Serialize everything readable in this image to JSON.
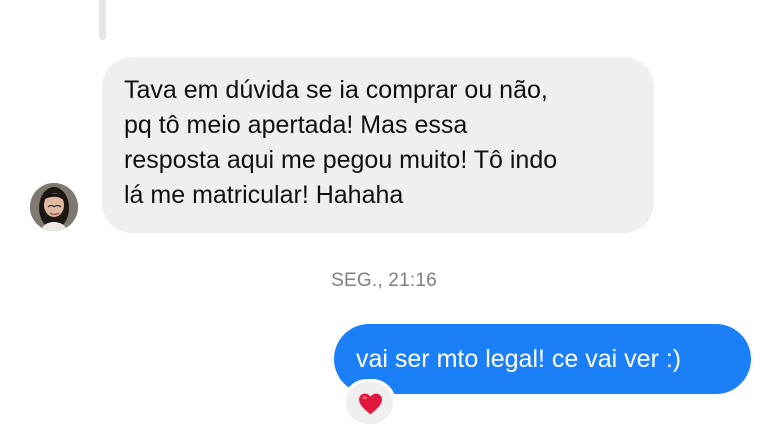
{
  "conversation": {
    "incoming_message": {
      "text": "Tava em dúvida se ia comprar ou não,\npq tô meio apertada! Mas essa\nresposta aqui me pegou muito! Tô indo\nlá me matricular! Hahaha"
    },
    "timestamp": "SEG., 21:16",
    "outgoing_message": {
      "text": "vai ser mto legal! ce vai ver :)"
    },
    "reaction": {
      "icon": "heart-icon",
      "color": "#e3173d"
    }
  },
  "colors": {
    "background": "#ffffff",
    "incoming_bubble": "#efefef",
    "outgoing_bubble": "#1b7ff7",
    "timestamp_text": "#7f7f7f"
  }
}
